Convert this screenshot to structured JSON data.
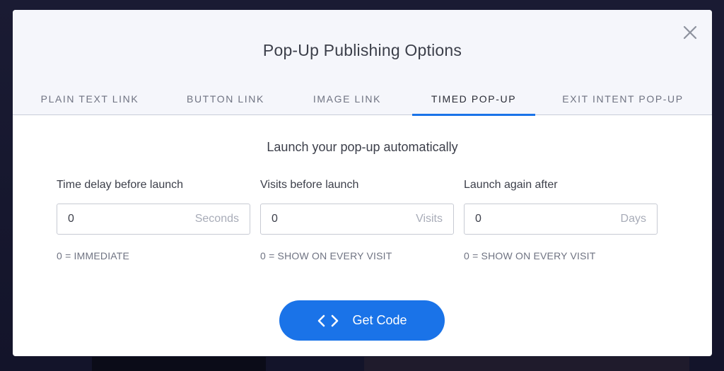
{
  "modal": {
    "title": "Pop-Up Publishing Options",
    "close_icon": "close-icon"
  },
  "tabs": [
    {
      "label": "PLAIN TEXT LINK",
      "active": false
    },
    {
      "label": "BUTTON LINK",
      "active": false
    },
    {
      "label": "IMAGE LINK",
      "active": false
    },
    {
      "label": "TIMED POP-UP",
      "active": true
    },
    {
      "label": "EXIT INTENT POP-UP",
      "active": false
    }
  ],
  "content": {
    "subtitle": "Launch your pop-up automatically",
    "fields": [
      {
        "label": "Time delay before launch",
        "value": "0",
        "unit": "Seconds",
        "hint": "0 = IMMEDIATE"
      },
      {
        "label": "Visits before launch",
        "value": "0",
        "unit": "Visits",
        "hint": "0 = SHOW ON EVERY VISIT"
      },
      {
        "label": "Launch again after",
        "value": "0",
        "unit": "Days",
        "hint": "0 = SHOW ON EVERY VISIT"
      }
    ]
  },
  "actions": {
    "get_code_label": "Get Code",
    "get_code_icon": "code-icon"
  },
  "colors": {
    "accent": "#1a73e8",
    "header_bg": "#f5f6fb",
    "backdrop": "#14152a"
  }
}
